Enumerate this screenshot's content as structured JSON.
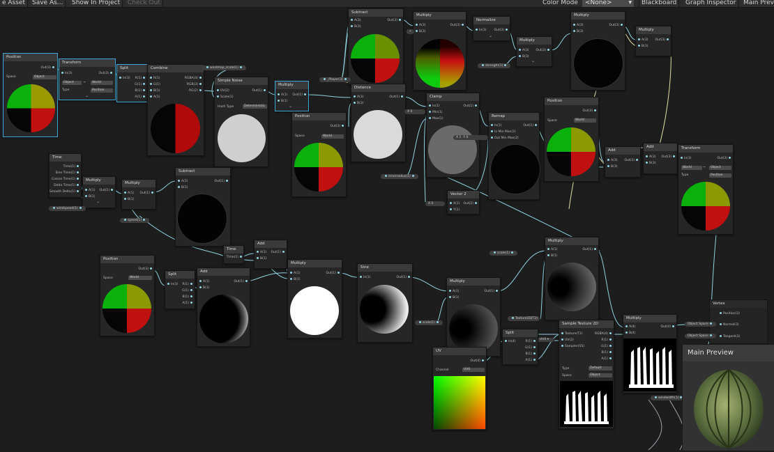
{
  "toolbar": {
    "save_asset": "e Asset",
    "save_as": "Save As...",
    "show_in_project": "Show In Project",
    "check_out": "Check Out",
    "color_mode_label": "Color Mode",
    "color_mode_value": "<None>",
    "blackboard": "Blackboard",
    "graph_inspector": "Graph Inspector",
    "main_preview": "Main Previ"
  },
  "nodes": {
    "position1": {
      "title": "Position",
      "out": "Out(3)",
      "space_label": "Space",
      "space_value": "Object"
    },
    "transform1": {
      "title": "Transform",
      "in": "In(3)",
      "out": "Out(3)",
      "from": "Object",
      "to": "World",
      "type_label": "Type",
      "type_value": "Position"
    },
    "split1": {
      "title": "Split",
      "in": "In(3)",
      "r": "R(1)",
      "g": "G(1)",
      "b": "B(1)",
      "a": "A(1)"
    },
    "combine": {
      "title": "Combine",
      "r": "R(1)",
      "g": "G(1)",
      "b": "B(1)",
      "a": "A(1)",
      "rgba": "RGBA(4)",
      "rgb": "RGB(3)",
      "rg": "RG(2)"
    },
    "simple_noise": {
      "title": "Simple Noise",
      "uv": "UV(2)",
      "scale": "Scale(1)",
      "out": "Out(1)",
      "hash_label": "Hash Type",
      "hash_value": "Deterministic"
    },
    "multiply1": {
      "title": "Multiply",
      "a": "A(1)",
      "b": "B(1)",
      "out": "Out(1)"
    },
    "subtract1": {
      "title": "Subtract",
      "a": "A(3)",
      "b": "B(3)",
      "out": "Out(3)"
    },
    "multiply2": {
      "title": "Multiply",
      "a": "A(3)",
      "b": "B(3)",
      "out": "Out(3)"
    },
    "normalize": {
      "title": "Normalize",
      "in": "In(3)",
      "out": "Out(3)"
    },
    "multiply3": {
      "title": "Multiply",
      "a": "A(3)",
      "b": "B(3)",
      "out": "Out(3)"
    },
    "multiply4": {
      "title": "Multiply",
      "a": "A(3)",
      "b": "B(3)",
      "out": "Out(3)"
    },
    "multiply5": {
      "title": "Multiply",
      "a": "A(3)",
      "b": "B(3)",
      "out": "Out(3)"
    },
    "distance": {
      "title": "Distance",
      "a": "A(3)",
      "b": "B(3)",
      "out": "Out(1)"
    },
    "clamp": {
      "title": "Clamp",
      "in": "In(1)",
      "min": "Min(1)",
      "max": "Max(1)",
      "out": "Out(1)",
      "x_label": "X",
      "min_val": "0"
    },
    "remap": {
      "title": "Remap",
      "in": "In(1)",
      "in_min_max": "In Min Max(2)",
      "out_min_max": "Out Min Max(2)",
      "out": "Out(1)",
      "x_label": "X",
      "x_val": "1",
      "y_label": "Y",
      "y_val": "0"
    },
    "position2": {
      "title": "Position",
      "out": "Out(3)",
      "space_label": "Space",
      "space_value": "World"
    },
    "position3": {
      "title": "Position",
      "out": "Out(3)",
      "space_label": "Space",
      "space_value": "World"
    },
    "add1": {
      "title": "Add",
      "a": "A(3)",
      "b": "B(3)",
      "out": "Out(3)"
    },
    "add2": {
      "title": "Add",
      "a": "A(3)",
      "b": "B(3)",
      "out": "Out(3)"
    },
    "transform2": {
      "title": "Transform",
      "in": "In(3)",
      "out": "Out(3)",
      "from": "World",
      "to": "Object",
      "type_label": "Type",
      "type_value": "Position"
    },
    "time1": {
      "title": "Time",
      "time": "Time(1)",
      "sine": "Sine Time(1)",
      "cosine": "Cosine Time(1)",
      "delta": "Delta Time(1)",
      "smooth": "Smooth Delta(1)"
    },
    "multiply6": {
      "title": "Multiply",
      "a": "A(1)",
      "b": "B(1)",
      "out": "Out(1)"
    },
    "multiply7": {
      "title": "Multiply",
      "a": "A(1)",
      "b": "B(1)",
      "out": "Out(1)"
    },
    "subtract2": {
      "title": "Subtract",
      "a": "A(1)",
      "b": "B(1)",
      "out": "Out(1)"
    },
    "vector2": {
      "title": "Vector 2",
      "x": "X(1)",
      "y": "Y(1)",
      "out": "Out(2)",
      "x_label": "X",
      "x_val": "0"
    },
    "time2": {
      "title": "Time",
      "time": "Time(1)"
    },
    "add3": {
      "title": "Add",
      "a": "A(1)",
      "b": "B(1)",
      "out": "Out(1)"
    },
    "position4": {
      "title": "Position",
      "out": "Out(3)",
      "space_label": "Space",
      "space_value": "World"
    },
    "split2": {
      "title": "Split",
      "in": "In(3)",
      "r": "R(1)",
      "g": "G(1)",
      "b": "B(1)",
      "a": "A(1)"
    },
    "add4": {
      "title": "Add",
      "a": "A(1)",
      "b": "B(1)",
      "out": "Out(1)"
    },
    "multiply8": {
      "title": "Multiply",
      "a": "A(1)",
      "b": "B(1)",
      "out": "Out(1)"
    },
    "sine": {
      "title": "Sine",
      "in": "In(1)",
      "out": "Out(1)"
    },
    "multiply9": {
      "title": "Multiply",
      "a": "A(1)",
      "b": "B(1)",
      "out": "Out(1)"
    },
    "multiply10": {
      "title": "Multiply",
      "a": "A(1)",
      "b": "B(1)",
      "out": "Out(1)"
    },
    "uv": {
      "title": "UV",
      "out": "Out(4)",
      "channel_label": "Channel",
      "channel_value": "UV0"
    },
    "split3": {
      "title": "Split",
      "in": "In(4)",
      "r": "R(1)",
      "g": "G(1)",
      "b": "B(1)",
      "a": "A(1)"
    },
    "sample_texture": {
      "title": "Sample Texture 2D",
      "texture": "Texture(T2)",
      "uv": "UV(2)",
      "sampler": "Sampler(SS)",
      "rgba": "RGBA(4)",
      "r": "R(1)",
      "g": "G(1)",
      "b": "B(1)",
      "a": "A(1)",
      "type_label": "Type",
      "type_value": "Default",
      "space_label": "Space",
      "space_value": "Object"
    },
    "multiply11": {
      "title": "Multiply",
      "a": "A(4)",
      "b": "B(4)",
      "out": "Out(4)"
    }
  },
  "pills": {
    "windmap": "windmap_scale(1)",
    "player": "_Player(3)",
    "strength": "strength(1)",
    "windspeed": "windspeed(1)",
    "speed": "speed(1)",
    "innerradius": "innerradius(1)",
    "scale1": "scale(1)",
    "scale2": "scale(1)",
    "texture2d": "Texture2D(T2)",
    "uv0": "UV0",
    "windwidth": "windwidth(1)"
  },
  "vertex": {
    "title": "Vertex",
    "position": "Position(3)",
    "normal": "Normal(3)",
    "tangent": "Tangent(3)",
    "space1": "Object Space",
    "space2": "Object Space"
  },
  "main_preview": {
    "title": "Main Preview"
  },
  "colors": {
    "wire": "#8fd3e0",
    "wire_float": "#87c3cf",
    "wire_vec3": "#e4e0a3",
    "selection": "#44a7d3",
    "node_bg": "#262626",
    "header": "#3a3a3a"
  }
}
